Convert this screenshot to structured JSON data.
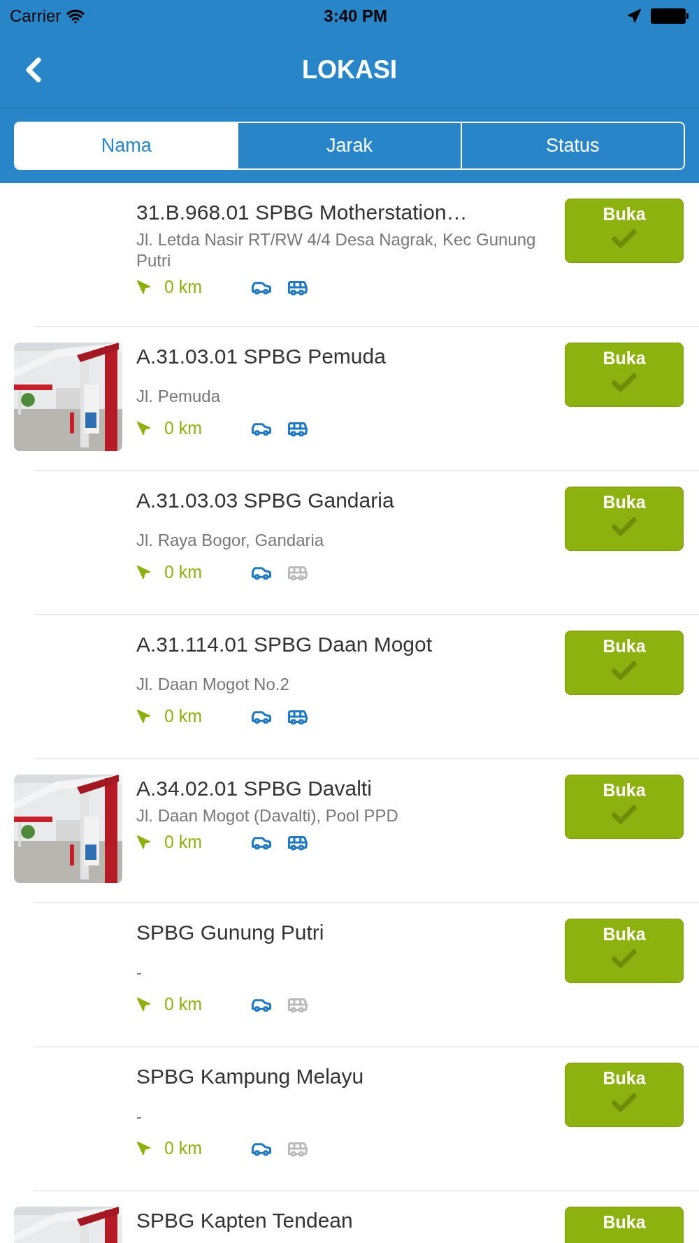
{
  "status_bar": {
    "carrier": "Carrier",
    "time": "3:40 PM"
  },
  "nav": {
    "title": "LOKASI"
  },
  "tabs": [
    {
      "label": "Nama",
      "selected": true
    },
    {
      "label": "Jarak",
      "selected": false
    },
    {
      "label": "Status",
      "selected": false
    }
  ],
  "stations": [
    {
      "name": "31.B.968.01 SPBG Motherstation…",
      "address": "Jl. Letda Nasir RT/RW 4/4 Desa Nagrak, Kec Gunung Putri",
      "photo": false,
      "distance": "0 km",
      "car": true,
      "bus": true,
      "status": "Buka"
    },
    {
      "name": "A.31.03.01 SPBG Pemuda",
      "address": "Jl. Pemuda",
      "photo": true,
      "distance": "0 km",
      "car": true,
      "bus": true,
      "status": "Buka"
    },
    {
      "name": "A.31.03.03 SPBG Gandaria",
      "address": "Jl. Raya Bogor, Gandaria",
      "photo": false,
      "distance": "0 km",
      "car": true,
      "bus": false,
      "status": "Buka"
    },
    {
      "name": "A.31.114.01 SPBG Daan Mogot",
      "address": "Jl. Daan Mogot No.2",
      "photo": false,
      "distance": "0 km",
      "car": true,
      "bus": true,
      "status": "Buka"
    },
    {
      "name": "A.34.02.01 SPBG Davalti",
      "address": "Jl. Daan Mogot (Davalti), Pool PPD",
      "photo": true,
      "distance": "0 km",
      "car": true,
      "bus": true,
      "status": "Buka"
    },
    {
      "name": "SPBG Gunung Putri",
      "address": "-",
      "photo": false,
      "distance": "0 km",
      "car": true,
      "bus": false,
      "status": "Buka"
    },
    {
      "name": "SPBG Kampung Melayu",
      "address": "-",
      "photo": false,
      "distance": "0 km",
      "car": true,
      "bus": false,
      "status": "Buka"
    },
    {
      "name": "SPBG Kapten Tendean",
      "photo": true,
      "status": "Buka"
    }
  ]
}
